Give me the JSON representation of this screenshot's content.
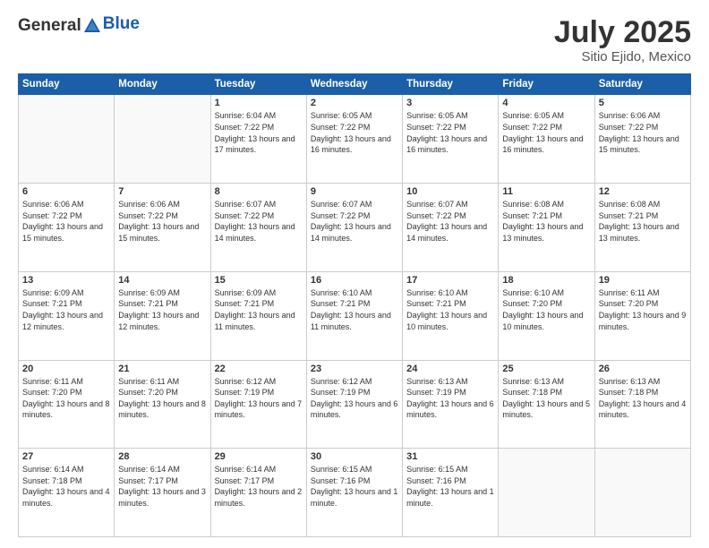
{
  "header": {
    "logo_general": "General",
    "logo_blue": "Blue",
    "month_year": "July 2025",
    "location": "Sitio Ejido, Mexico"
  },
  "weekdays": [
    "Sunday",
    "Monday",
    "Tuesday",
    "Wednesday",
    "Thursday",
    "Friday",
    "Saturday"
  ],
  "weeks": [
    [
      {
        "day": "",
        "info": ""
      },
      {
        "day": "",
        "info": ""
      },
      {
        "day": "1",
        "info": "Sunrise: 6:04 AM\nSunset: 7:22 PM\nDaylight: 13 hours and 17 minutes."
      },
      {
        "day": "2",
        "info": "Sunrise: 6:05 AM\nSunset: 7:22 PM\nDaylight: 13 hours and 16 minutes."
      },
      {
        "day": "3",
        "info": "Sunrise: 6:05 AM\nSunset: 7:22 PM\nDaylight: 13 hours and 16 minutes."
      },
      {
        "day": "4",
        "info": "Sunrise: 6:05 AM\nSunset: 7:22 PM\nDaylight: 13 hours and 16 minutes."
      },
      {
        "day": "5",
        "info": "Sunrise: 6:06 AM\nSunset: 7:22 PM\nDaylight: 13 hours and 15 minutes."
      }
    ],
    [
      {
        "day": "6",
        "info": "Sunrise: 6:06 AM\nSunset: 7:22 PM\nDaylight: 13 hours and 15 minutes."
      },
      {
        "day": "7",
        "info": "Sunrise: 6:06 AM\nSunset: 7:22 PM\nDaylight: 13 hours and 15 minutes."
      },
      {
        "day": "8",
        "info": "Sunrise: 6:07 AM\nSunset: 7:22 PM\nDaylight: 13 hours and 14 minutes."
      },
      {
        "day": "9",
        "info": "Sunrise: 6:07 AM\nSunset: 7:22 PM\nDaylight: 13 hours and 14 minutes."
      },
      {
        "day": "10",
        "info": "Sunrise: 6:07 AM\nSunset: 7:22 PM\nDaylight: 13 hours and 14 minutes."
      },
      {
        "day": "11",
        "info": "Sunrise: 6:08 AM\nSunset: 7:21 PM\nDaylight: 13 hours and 13 minutes."
      },
      {
        "day": "12",
        "info": "Sunrise: 6:08 AM\nSunset: 7:21 PM\nDaylight: 13 hours and 13 minutes."
      }
    ],
    [
      {
        "day": "13",
        "info": "Sunrise: 6:09 AM\nSunset: 7:21 PM\nDaylight: 13 hours and 12 minutes."
      },
      {
        "day": "14",
        "info": "Sunrise: 6:09 AM\nSunset: 7:21 PM\nDaylight: 13 hours and 12 minutes."
      },
      {
        "day": "15",
        "info": "Sunrise: 6:09 AM\nSunset: 7:21 PM\nDaylight: 13 hours and 11 minutes."
      },
      {
        "day": "16",
        "info": "Sunrise: 6:10 AM\nSunset: 7:21 PM\nDaylight: 13 hours and 11 minutes."
      },
      {
        "day": "17",
        "info": "Sunrise: 6:10 AM\nSunset: 7:21 PM\nDaylight: 13 hours and 10 minutes."
      },
      {
        "day": "18",
        "info": "Sunrise: 6:10 AM\nSunset: 7:20 PM\nDaylight: 13 hours and 10 minutes."
      },
      {
        "day": "19",
        "info": "Sunrise: 6:11 AM\nSunset: 7:20 PM\nDaylight: 13 hours and 9 minutes."
      }
    ],
    [
      {
        "day": "20",
        "info": "Sunrise: 6:11 AM\nSunset: 7:20 PM\nDaylight: 13 hours and 8 minutes."
      },
      {
        "day": "21",
        "info": "Sunrise: 6:11 AM\nSunset: 7:20 PM\nDaylight: 13 hours and 8 minutes."
      },
      {
        "day": "22",
        "info": "Sunrise: 6:12 AM\nSunset: 7:19 PM\nDaylight: 13 hours and 7 minutes."
      },
      {
        "day": "23",
        "info": "Sunrise: 6:12 AM\nSunset: 7:19 PM\nDaylight: 13 hours and 6 minutes."
      },
      {
        "day": "24",
        "info": "Sunrise: 6:13 AM\nSunset: 7:19 PM\nDaylight: 13 hours and 6 minutes."
      },
      {
        "day": "25",
        "info": "Sunrise: 6:13 AM\nSunset: 7:18 PM\nDaylight: 13 hours and 5 minutes."
      },
      {
        "day": "26",
        "info": "Sunrise: 6:13 AM\nSunset: 7:18 PM\nDaylight: 13 hours and 4 minutes."
      }
    ],
    [
      {
        "day": "27",
        "info": "Sunrise: 6:14 AM\nSunset: 7:18 PM\nDaylight: 13 hours and 4 minutes."
      },
      {
        "day": "28",
        "info": "Sunrise: 6:14 AM\nSunset: 7:17 PM\nDaylight: 13 hours and 3 minutes."
      },
      {
        "day": "29",
        "info": "Sunrise: 6:14 AM\nSunset: 7:17 PM\nDaylight: 13 hours and 2 minutes."
      },
      {
        "day": "30",
        "info": "Sunrise: 6:15 AM\nSunset: 7:16 PM\nDaylight: 13 hours and 1 minute."
      },
      {
        "day": "31",
        "info": "Sunrise: 6:15 AM\nSunset: 7:16 PM\nDaylight: 13 hours and 1 minute."
      },
      {
        "day": "",
        "info": ""
      },
      {
        "day": "",
        "info": ""
      }
    ]
  ]
}
